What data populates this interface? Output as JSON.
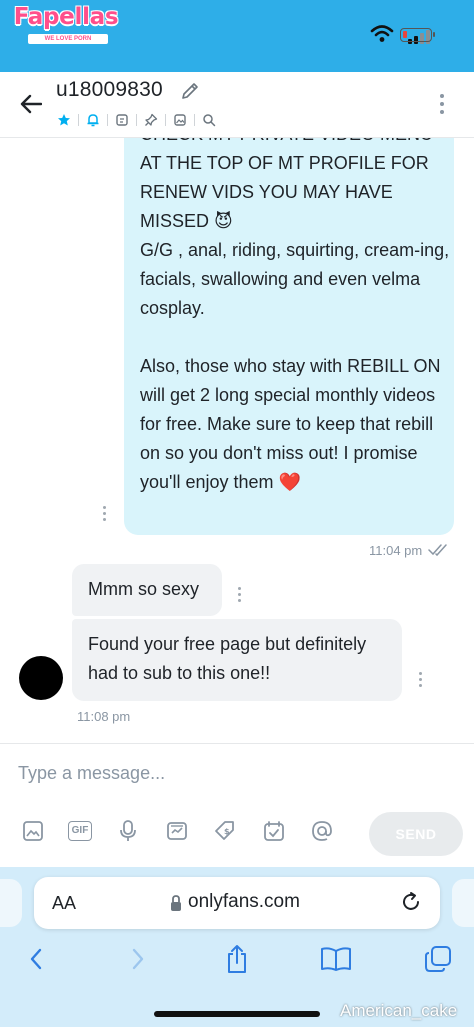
{
  "watermark": {
    "title": "Fapellas",
    "subtitle": "WE LOVE PORN"
  },
  "header": {
    "username": "u18009830"
  },
  "messages": {
    "outgoing_text": "CHECK MY PRIVATE VIDEO MENU AT THE TOP OF MT PROFILE FOR RENEW VIDS YOU MAY HAVE MISSED 😈\nG/G , anal, riding, squirting, cream-ing, facials, swallowing and even velma cosplay.\n\nAlso, those who stay with REBILL ON will get 2 long special monthly videos for free. Make sure to keep that rebill on so you don't miss out! I promise you'll enjoy them ❤️",
    "outgoing_time": "11:04 pm",
    "incoming_1": "Mmm so sexy",
    "incoming_2": "Found your free page but definitely had to sub to this one!!",
    "incoming_time": "11:08 pm"
  },
  "composer": {
    "placeholder": "Type a message...",
    "send_label": "SEND",
    "gif_label": "GIF"
  },
  "browser": {
    "text_size_label": "AA",
    "url": "onlyfans.com"
  },
  "credit": "American_cake",
  "colors": {
    "status_bar": "#2eaee8",
    "accent": "#00aff0",
    "outgoing_bubble": "#d9f4fb",
    "incoming_bubble": "#f0f2f4",
    "safari_bar": "#d3ecfa"
  }
}
